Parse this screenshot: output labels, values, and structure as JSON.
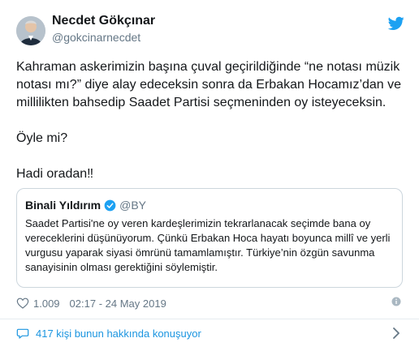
{
  "author": {
    "name": "Necdet Gökçınar",
    "handle": "@gokcinarnecdet"
  },
  "tweet": {
    "lines": [
      "Kahraman askerimizin başına çuval geçirildiğinde “ne notası müzik notası mı?” diye alay edeceksin sonra da Erbakan Hocamız’dan ve millilikten bahsedip Saadet Partisi seçmeninden oy isteyeceksin.",
      "Öyle mi?",
      "Hadi oradan‼"
    ]
  },
  "quoted_tweet": {
    "name": "Binali Yıldırım",
    "handle": "@BY",
    "text": "Saadet Partisi'ne oy veren kardeşlerimizin tekrarlanacak seçimde bana oy vereceklerini düşünüyorum. Çünkü Erbakan Hoca hayatı boyunca millî ve yerli vurgusu yaparak siyasi ömrünü tamamlamıştır. Türkiye’nin özgün savunma sanayisinin olması gerektiğini söylemiştir."
  },
  "meta": {
    "likes": "1.009",
    "timestamp": "02:17 - 24 May 2019"
  },
  "conversation": {
    "label": "417 kişi bunun hakkında konuşuyor"
  },
  "icons": {
    "logo": "twitter-bird-icon",
    "like": "heart-icon",
    "info": "info-icon",
    "verified": "verified-badge-icon",
    "conversation": "comment-bubble-icon",
    "more": "chevron-right-icon"
  },
  "colors": {
    "brand": "#1da1f2",
    "link": "#1b95e0",
    "muted": "#657786",
    "border": "#ccd6dd"
  }
}
